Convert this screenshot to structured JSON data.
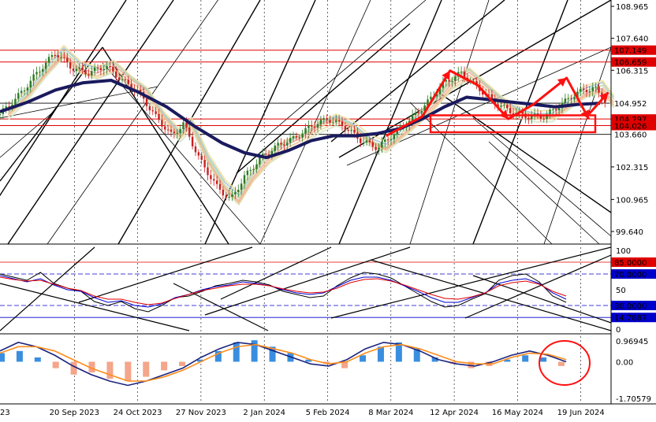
{
  "chart_data": [
    {
      "panel": "price",
      "type": "candlestick",
      "y_ticks": [
        "108.965",
        "107.640",
        "106.315",
        "102.315",
        "100.965",
        "99.640"
      ],
      "hlines": [
        {
          "label": "107.149",
          "value": 107.149,
          "color": "#e00000",
          "style": "tag"
        },
        {
          "label": "106.659",
          "value": 106.659,
          "color": "#e00000",
          "style": "tag"
        },
        {
          "label": "104.952",
          "value": 104.952,
          "color": "#000000",
          "style": "plain"
        },
        {
          "label": "104.297",
          "value": 104.297,
          "color": "#e00000",
          "style": "tag"
        },
        {
          "label": "104.026",
          "value": 104.026,
          "color": "#e00000",
          "style": "tag"
        },
        {
          "label": "103.660",
          "value": 103.66,
          "color": "#000000",
          "style": "plain"
        }
      ],
      "x_ticks": [
        "23",
        "20 Sep 2023",
        "24 Oct 2023",
        "27 Nov 2023",
        "2 Jan 2024",
        "5 Feb 2024",
        "8 Mar 2024",
        "12 Apr 2024",
        "16 May 2024",
        "19 Jun 2024"
      ],
      "close_path": [
        [
          0.0,
          104.5
        ],
        [
          0.35,
          105.3
        ],
        [
          0.7,
          106.3
        ],
        [
          1.0,
          107.05
        ],
        [
          1.3,
          106.4
        ],
        [
          1.6,
          106.2
        ],
        [
          1.9,
          106.5
        ],
        [
          2.2,
          105.9
        ],
        [
          2.5,
          105.4
        ],
        [
          2.8,
          104.4
        ],
        [
          3.1,
          103.6
        ],
        [
          3.3,
          104.1
        ],
        [
          3.6,
          102.6
        ],
        [
          3.9,
          101.5
        ],
        [
          4.15,
          100.95
        ],
        [
          4.4,
          101.9
        ],
        [
          4.7,
          102.7
        ],
        [
          5.0,
          103.2
        ],
        [
          5.3,
          103.5
        ],
        [
          5.6,
          104.0
        ],
        [
          5.9,
          104.3
        ],
        [
          6.2,
          104.0
        ],
        [
          6.5,
          103.4
        ],
        [
          6.8,
          103.1
        ],
        [
          7.1,
          103.7
        ],
        [
          7.4,
          104.3
        ],
        [
          7.7,
          105.0
        ],
        [
          8.0,
          105.8
        ],
        [
          8.3,
          106.2
        ],
        [
          8.6,
          105.6
        ],
        [
          8.9,
          105.0
        ],
        [
          9.2,
          104.6
        ],
        [
          9.5,
          104.4
        ],
        [
          9.8,
          104.4
        ],
        [
          10.1,
          104.9
        ],
        [
          10.4,
          105.4
        ],
        [
          10.7,
          105.6
        ],
        [
          10.9,
          105.0
        ]
      ],
      "ma_thick": [
        [
          0.0,
          104.6
        ],
        [
          0.5,
          105.0
        ],
        [
          1.0,
          105.5
        ],
        [
          1.5,
          105.8
        ],
        [
          2.0,
          105.9
        ],
        [
          2.5,
          105.4
        ],
        [
          3.0,
          104.8
        ],
        [
          3.5,
          104.0
        ],
        [
          4.0,
          103.3
        ],
        [
          4.4,
          102.9
        ],
        [
          4.8,
          102.7
        ],
        [
          5.2,
          103.0
        ],
        [
          5.6,
          103.4
        ],
        [
          6.0,
          103.6
        ],
        [
          6.4,
          103.6
        ],
        [
          6.8,
          103.7
        ],
        [
          7.2,
          103.9
        ],
        [
          7.6,
          104.3
        ],
        [
          8.0,
          104.8
        ],
        [
          8.4,
          105.2
        ],
        [
          8.8,
          105.1
        ],
        [
          9.2,
          105.0
        ],
        [
          9.6,
          104.9
        ],
        [
          10.0,
          104.8
        ],
        [
          10.4,
          104.9
        ],
        [
          10.8,
          104.95
        ]
      ],
      "annotation_path": [
        [
          6.95,
          103.6
        ],
        [
          7.6,
          104.4
        ],
        [
          8.1,
          106.3
        ],
        [
          8.6,
          105.7
        ],
        [
          9.15,
          104.3
        ],
        [
          9.6,
          104.9
        ],
        [
          10.2,
          106.0
        ],
        [
          10.6,
          104.3
        ]
      ],
      "annotation_arrow_up": [
        10.6,
        104.5,
        10.95,
        105.4
      ]
    },
    {
      "panel": "oscillator",
      "type": "line",
      "y_ticks": [
        "100",
        "85.0000",
        "70.0000",
        "50",
        "30.0000",
        "14.7887",
        "0"
      ],
      "levels": [
        85.0,
        70.0,
        30.0,
        14.7887
      ],
      "series": [
        {
          "color": "#000000",
          "values": [
            70,
            66,
            62,
            72,
            58,
            52,
            48,
            35,
            30,
            35,
            26,
            22,
            30,
            40,
            42,
            48,
            55,
            58,
            62,
            60,
            56,
            48,
            44,
            40,
            42,
            55,
            65,
            72,
            70,
            65,
            55,
            45,
            35,
            28,
            30,
            38,
            45,
            62,
            68,
            70,
            60,
            42,
            34
          ]
        },
        {
          "color": "#0000cc",
          "values": [
            68,
            64,
            60,
            64,
            56,
            50,
            48,
            40,
            34,
            36,
            30,
            28,
            32,
            40,
            44,
            50,
            54,
            56,
            60,
            58,
            55,
            50,
            46,
            44,
            46,
            54,
            62,
            66,
            66,
            62,
            55,
            48,
            40,
            34,
            34,
            40,
            46,
            58,
            62,
            64,
            58,
            46,
            38
          ]
        },
        {
          "color": "#e00000",
          "values": [
            66,
            63,
            61,
            62,
            57,
            52,
            49,
            42,
            38,
            38,
            34,
            31,
            33,
            39,
            44,
            49,
            52,
            55,
            57,
            57,
            55,
            51,
            48,
            46,
            47,
            52,
            59,
            63,
            64,
            61,
            56,
            50,
            44,
            39,
            38,
            41,
            46,
            55,
            59,
            61,
            57,
            48,
            42
          ]
        }
      ]
    },
    {
      "panel": "macd",
      "type": "bar+line",
      "y_ticks": [
        "0.96945",
        "0.00",
        "-1.70579"
      ],
      "histogram": [
        0.4,
        0.5,
        0.2,
        -0.3,
        -0.6,
        -0.5,
        -0.8,
        -0.9,
        -0.7,
        -0.4,
        -0.2,
        0.1,
        0.5,
        0.9,
        1.0,
        0.7,
        0.4,
        0.1,
        -0.1,
        -0.3,
        0.3,
        0.7,
        0.9,
        0.6,
        0.2,
        -0.1,
        -0.3,
        -0.2,
        0.1,
        0.3,
        0.2,
        -0.2
      ],
      "line_dark": [
        0.5,
        0.9,
        0.7,
        0.3,
        -0.2,
        -0.6,
        -0.9,
        -1.1,
        -0.9,
        -0.6,
        -0.3,
        0.2,
        0.6,
        0.9,
        0.8,
        0.5,
        0.2,
        -0.1,
        -0.2,
        0.1,
        0.6,
        0.9,
        0.8,
        0.5,
        0.1,
        -0.1,
        -0.2,
        0.0,
        0.3,
        0.5,
        0.3,
        0.0
      ],
      "line_orange": [
        0.4,
        0.7,
        0.7,
        0.5,
        0.1,
        -0.3,
        -0.6,
        -0.9,
        -0.9,
        -0.7,
        -0.4,
        0.0,
        0.4,
        0.7,
        0.8,
        0.6,
        0.4,
        0.1,
        -0.1,
        0.0,
        0.4,
        0.7,
        0.8,
        0.6,
        0.3,
        0.0,
        -0.1,
        -0.1,
        0.2,
        0.4,
        0.35,
        0.1
      ]
    }
  ]
}
